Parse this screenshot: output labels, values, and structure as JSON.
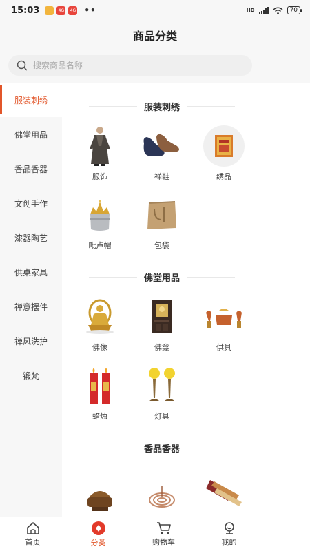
{
  "status_bar": {
    "time": "15:03",
    "notifications": [
      "",
      "4G",
      "4G"
    ],
    "dots": "••",
    "signal": "HD",
    "battery": "70"
  },
  "header": {
    "title": "商品分类"
  },
  "search": {
    "placeholder": "搜索商品名称"
  },
  "sidebar": {
    "items": [
      {
        "label": "服装刺绣",
        "active": true
      },
      {
        "label": "佛堂用品"
      },
      {
        "label": "香品香器"
      },
      {
        "label": "文创手作"
      },
      {
        "label": "漆器陶艺"
      },
      {
        "label": "供桌家具"
      },
      {
        "label": "禅意摆件"
      },
      {
        "label": "禅风洗护"
      },
      {
        "label": "锻梵"
      }
    ]
  },
  "sections": [
    {
      "title": "服装刺绣",
      "items": [
        {
          "label": "服饰",
          "icon": "robe-icon"
        },
        {
          "label": "禅鞋",
          "icon": "shoes-icon"
        },
        {
          "label": "绣品",
          "icon": "embroidery-icon"
        },
        {
          "label": "毗卢帽",
          "icon": "crown-hat-icon"
        },
        {
          "label": "包袋",
          "icon": "bag-icon"
        }
      ]
    },
    {
      "title": "佛堂用品",
      "items": [
        {
          "label": "佛像",
          "icon": "buddha-statue-icon"
        },
        {
          "label": "佛龛",
          "icon": "shrine-icon"
        },
        {
          "label": "供具",
          "icon": "offering-set-icon"
        },
        {
          "label": "蜡烛",
          "icon": "candles-icon"
        },
        {
          "label": "灯具",
          "icon": "lamps-icon"
        }
      ]
    },
    {
      "title": "香品香器",
      "items": [
        {
          "label": "",
          "icon": "censer-icon"
        },
        {
          "label": "",
          "icon": "coil-incense-icon"
        },
        {
          "label": "",
          "icon": "incense-box-icon"
        }
      ]
    }
  ],
  "bottom_nav": {
    "items": [
      {
        "label": "首页",
        "icon": "home-icon"
      },
      {
        "label": "分类",
        "icon": "category-icon",
        "active": true
      },
      {
        "label": "购物车",
        "icon": "cart-icon"
      },
      {
        "label": "我的",
        "icon": "profile-icon"
      }
    ]
  },
  "colors": {
    "accent": "#e2562a",
    "background": "#f7f7f7"
  }
}
